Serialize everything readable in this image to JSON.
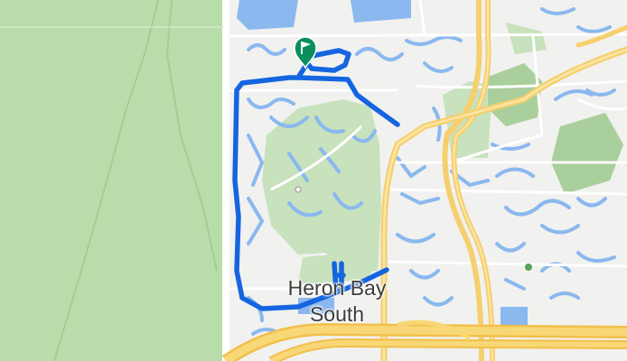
{
  "map": {
    "place_label": {
      "line1": "Heron Bay",
      "line2": "South"
    },
    "marker": {
      "type": "flag",
      "icon": "start-flag-icon",
      "color": "#0a8f5c"
    },
    "route": {
      "color": "#1565e0"
    },
    "colors": {
      "land": "#f1f1ef",
      "park": "#c7e2bd",
      "park_dark": "#a9cf9c",
      "water": "#8ab8ef",
      "road": "#ffffff",
      "highway": "#f6cf6e"
    }
  }
}
